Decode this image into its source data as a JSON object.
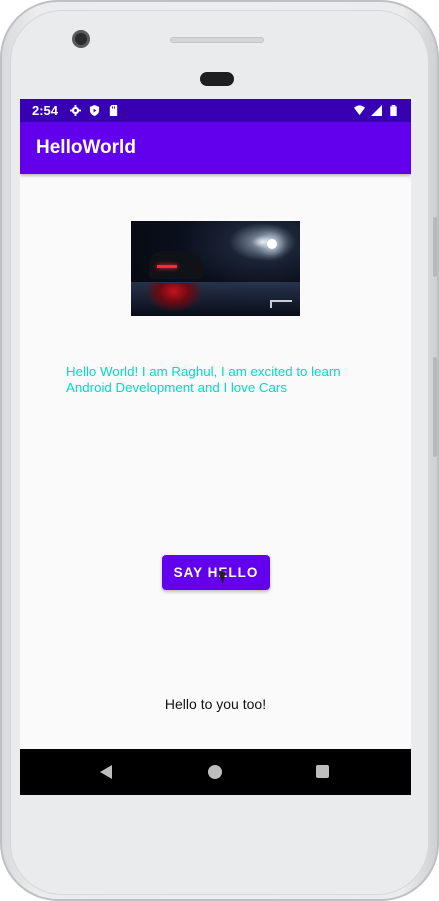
{
  "status_bar": {
    "time": "2:54",
    "left_icons": [
      "gear-icon",
      "shield-icon",
      "sd-card-icon"
    ],
    "right_icons": [
      "wifi-icon",
      "signal-icon",
      "battery-icon"
    ],
    "background_color": "#3700b3"
  },
  "app_bar": {
    "title": "HelloWorld",
    "background_color": "#6200ee"
  },
  "main": {
    "image": "car-photo",
    "intro_text": "Hello World! I am Raghul, I am excited to learn Android Development and I love Cars",
    "intro_text_color": "#03dac5",
    "button_label": "SAY HELLO",
    "reply_text": "Hello to you too!"
  },
  "nav_bar": {
    "icons": [
      "back-icon",
      "home-icon",
      "recents-icon"
    ]
  }
}
